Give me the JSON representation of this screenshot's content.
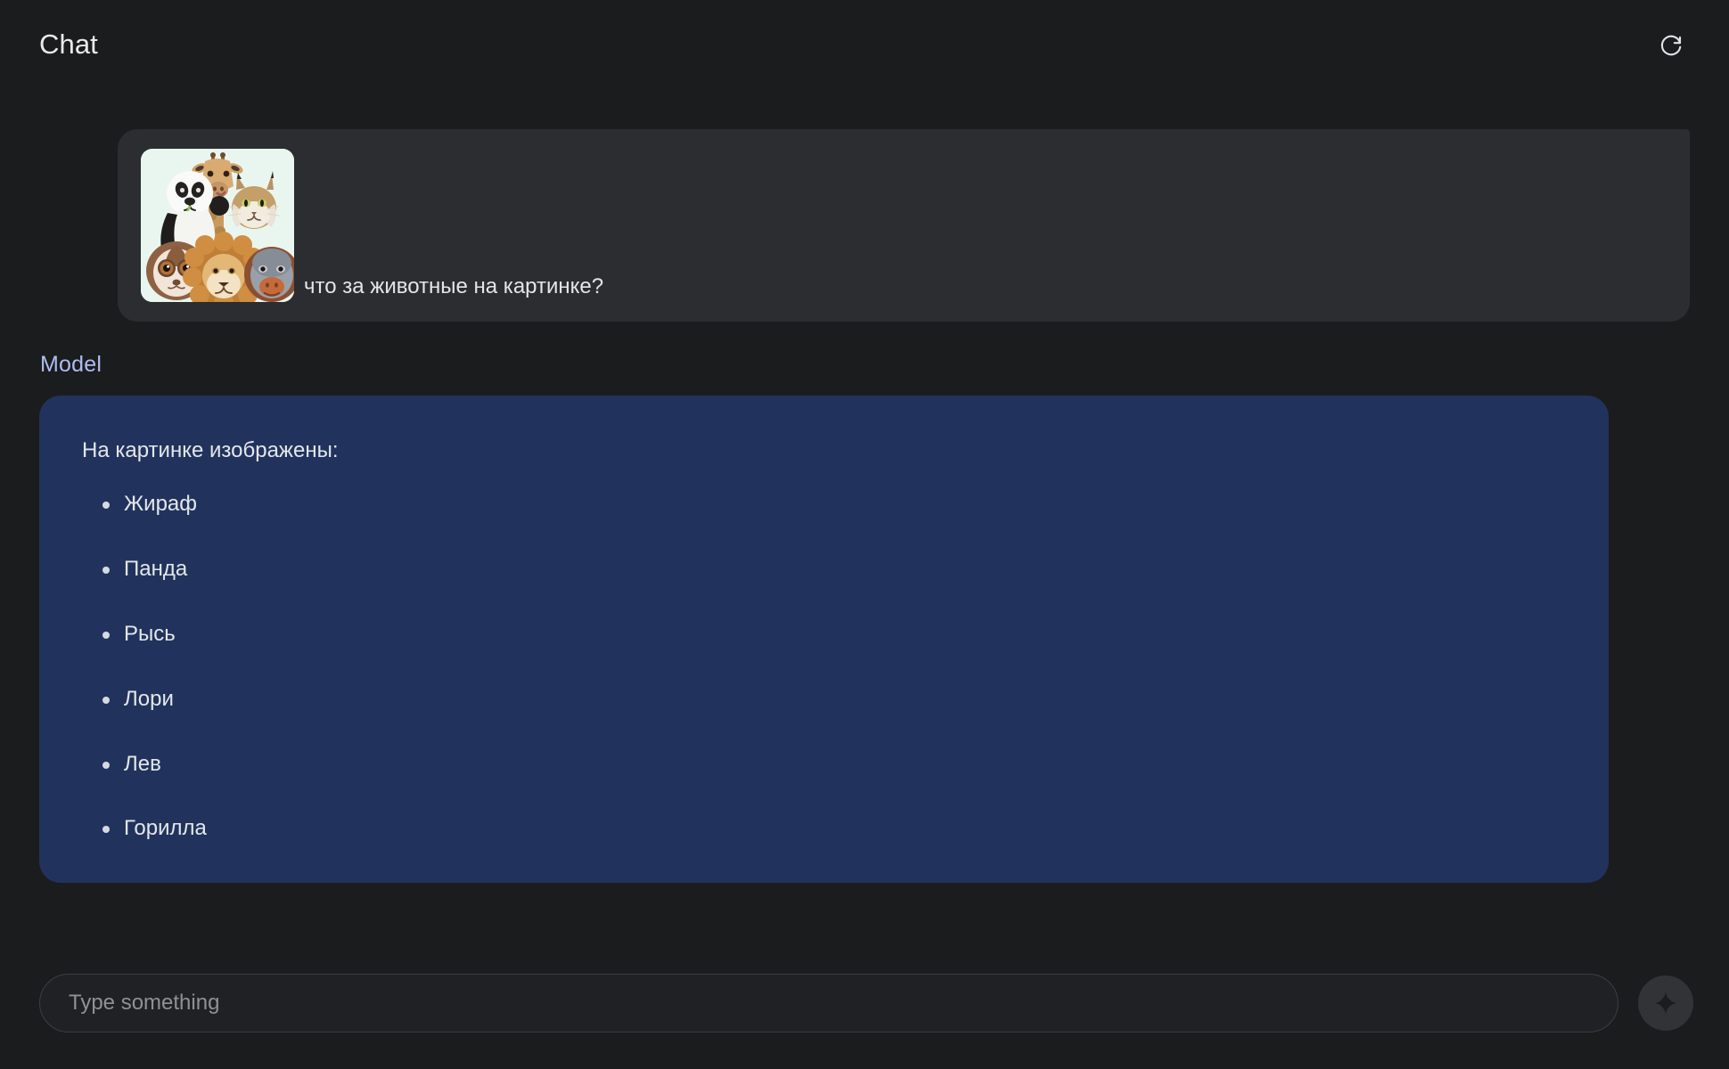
{
  "header": {
    "title": "Chat",
    "refresh_icon": "refresh-icon"
  },
  "conversation": {
    "user_message": {
      "text": "что за животные на картинке?",
      "attachment": {
        "icon": "image-thumbnail",
        "alt": "Collage of animals: giraffe, panda, lynx, slow loris, lion, orangutan",
        "background_color": "#e9f6f0"
      }
    },
    "model_label": "Model",
    "model_response": {
      "intro": "На картинке изображены:",
      "items": [
        "Жираф",
        "Панда",
        "Рысь",
        "Лори",
        "Лев",
        "Горилла"
      ]
    }
  },
  "composer": {
    "placeholder": "Type something",
    "value": "",
    "send_icon": "sparkle-icon"
  },
  "colors": {
    "page_background": "#1b1c1e",
    "user_bubble": "#2b2d30",
    "model_panel": "#21335c",
    "model_label": "#aebdf0",
    "text_primary": "#e4e6ea",
    "placeholder": "#8e9196",
    "send_button": "#313337"
  }
}
